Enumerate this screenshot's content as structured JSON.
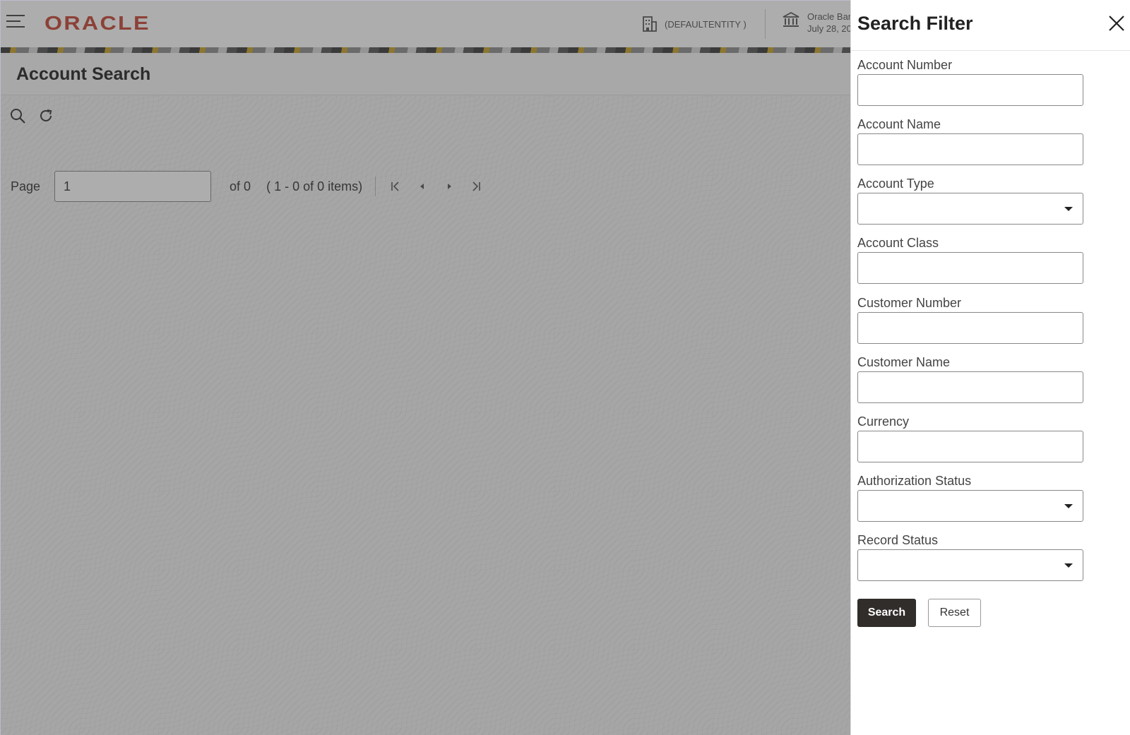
{
  "header": {
    "logo_text": "ORACLE",
    "entity_label": "(DEFAULTENTITY )",
    "bank_name": "Oracle Ban",
    "bank_date": "July 28, 20"
  },
  "page": {
    "title": "Account Search"
  },
  "toolbar": {
    "search_icon": "search-icon",
    "refresh_icon": "refresh-icon"
  },
  "pagination": {
    "page_label": "Page",
    "page_value": "1",
    "of_text": "of 0",
    "items_text": "( 1 - 0 of 0 items)"
  },
  "filter": {
    "title": "Search Filter",
    "fields": [
      {
        "label": "Account Number",
        "type": "text",
        "value": ""
      },
      {
        "label": "Account Name",
        "type": "text",
        "value": ""
      },
      {
        "label": "Account Type",
        "type": "select",
        "value": ""
      },
      {
        "label": "Account Class",
        "type": "text",
        "value": ""
      },
      {
        "label": "Customer Number",
        "type": "text",
        "value": ""
      },
      {
        "label": "Customer Name",
        "type": "text",
        "value": ""
      },
      {
        "label": "Currency",
        "type": "text",
        "value": ""
      },
      {
        "label": "Authorization Status",
        "type": "select",
        "value": ""
      },
      {
        "label": "Record Status",
        "type": "select",
        "value": ""
      }
    ],
    "search_label": "Search",
    "reset_label": "Reset"
  },
  "colors": {
    "brand": "#c74634",
    "primary_button": "#312d2a",
    "overlay": "#3c3c3c"
  }
}
